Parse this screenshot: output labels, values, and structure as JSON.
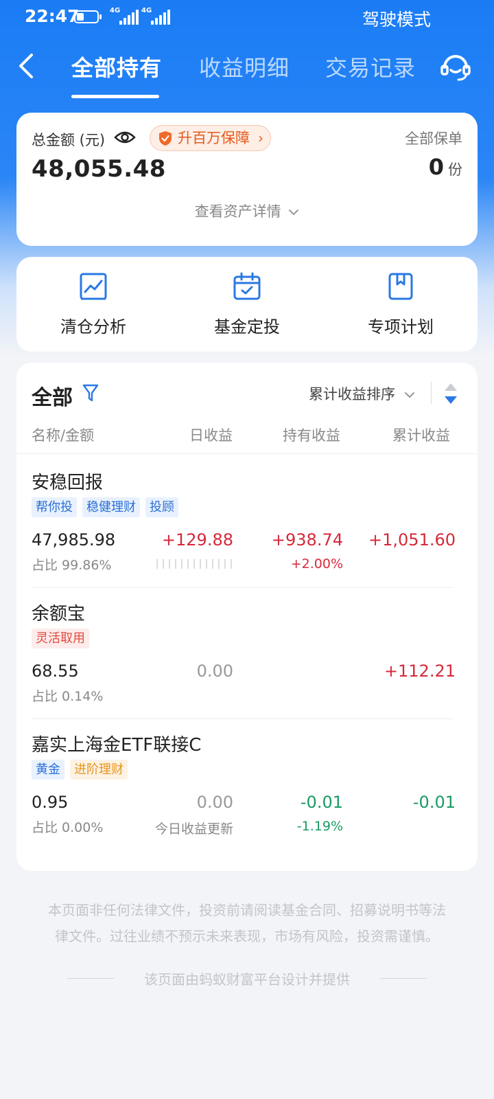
{
  "status_bar": {
    "time": "22:47",
    "net1": "4G",
    "net2": "4G",
    "mode": "驾驶模式"
  },
  "nav": {
    "tabs": [
      {
        "label": "全部持有",
        "active": true
      },
      {
        "label": "收益明细",
        "active": false
      },
      {
        "label": "交易记录",
        "active": false
      }
    ]
  },
  "summary": {
    "total_label": "总金额 (元)",
    "guard_badge": "升百万保障",
    "total_value": "48,055.48",
    "policy_label": "全部保单",
    "policy_count": "0",
    "policy_unit": "份",
    "detail_link": "查看资产详情"
  },
  "tools": [
    {
      "label": "清仓分析",
      "icon": "chart-line-icon"
    },
    {
      "label": "基金定投",
      "icon": "calendar-check-icon"
    },
    {
      "label": "专项计划",
      "icon": "bookmark-book-icon"
    }
  ],
  "holdings": {
    "title": "全部",
    "sort_label": "累计收益排序",
    "columns": {
      "name": "名称/金额",
      "daily": "日收益",
      "hold": "持有收益",
      "cumulative": "累计收益"
    },
    "funds": [
      {
        "name": "安稳回报",
        "tags": [
          {
            "label": "帮你投",
            "style": "blue"
          },
          {
            "label": "稳健理财",
            "style": "blue"
          },
          {
            "label": "投顾",
            "style": "blue"
          }
        ],
        "amount": "47,985.98",
        "ratio": "占比 99.86%",
        "daily": "+129.88",
        "daily_sub": "",
        "hold": "+938.74",
        "hold_sub": "+2.00%",
        "cumulative": "+1,051.60"
      },
      {
        "name": "余额宝",
        "tags": [
          {
            "label": "灵活取用",
            "style": "red"
          }
        ],
        "amount": "68.55",
        "ratio": "占比 0.14%",
        "daily": "0.00",
        "daily_sub": "",
        "hold": "",
        "hold_sub": "",
        "cumulative": "+112.21"
      },
      {
        "name": "嘉实上海金ETF联接C",
        "tags": [
          {
            "label": "黄金",
            "style": "blue"
          },
          {
            "label": "进阶理财",
            "style": "orange"
          }
        ],
        "amount": "0.95",
        "ratio": "占比 0.00%",
        "daily": "0.00",
        "daily_sub": "今日收益更新",
        "hold": "-0.01",
        "hold_sub": "-1.19%",
        "cumulative": "-0.01"
      }
    ]
  },
  "footer": {
    "disclaimer_line1": "本页面非任何法律文件，投资前请阅读基金合同、招募说明书等法",
    "disclaimer_line2": "律文件。过往业绩不预示未来表现，市场有风险，投资需谨慎。",
    "provider": "该页面由蚂蚁财富平台设计并提供"
  },
  "colors": {
    "primary": "#1a7cf5",
    "positive": "#d6293b",
    "negative": "#1a9a63",
    "guard": "#e35a1a"
  }
}
